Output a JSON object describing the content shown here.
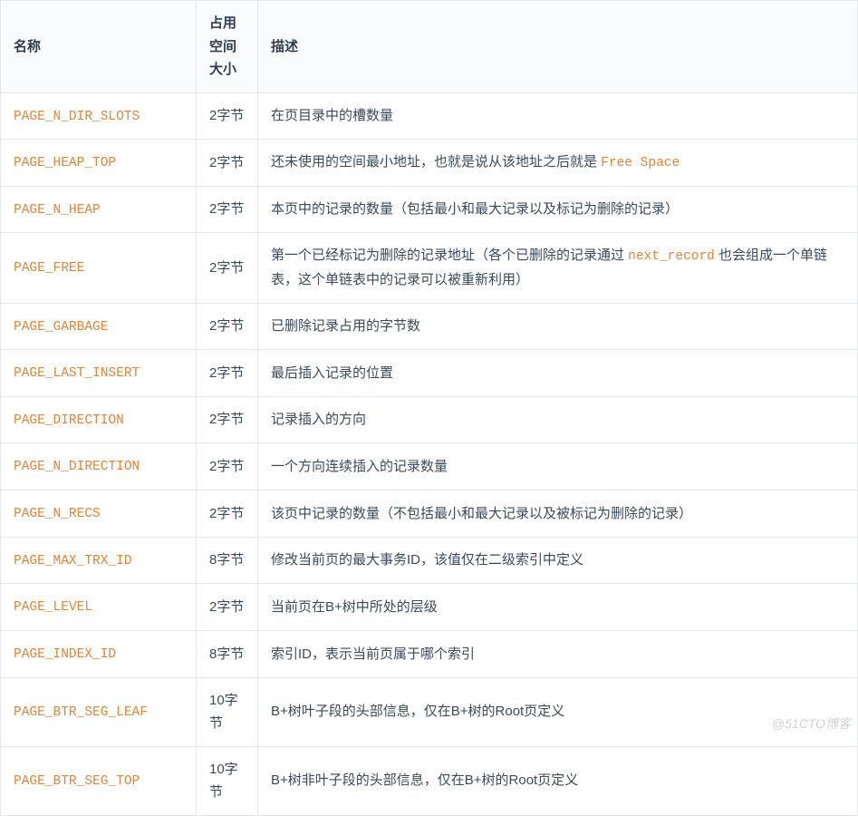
{
  "headers": {
    "name": "名称",
    "size": "占用空间大小",
    "desc": "描述"
  },
  "rows": [
    {
      "name": "PAGE_N_DIR_SLOTS",
      "size": "2字节",
      "desc_pre": "在页目录中的槽数量",
      "code": "",
      "desc_post": ""
    },
    {
      "name": "PAGE_HEAP_TOP",
      "size": "2字节",
      "desc_pre": "还未使用的空间最小地址，也就是说从该地址之后就是 ",
      "code": "Free Space",
      "desc_post": ""
    },
    {
      "name": "PAGE_N_HEAP",
      "size": "2字节",
      "desc_pre": "本页中的记录的数量（包括最小和最大记录以及标记为删除的记录）",
      "code": "",
      "desc_post": ""
    },
    {
      "name": "PAGE_FREE",
      "size": "2字节",
      "desc_pre": "第一个已经标记为删除的记录地址（各个已删除的记录通过 ",
      "code": "next_record",
      "desc_post": " 也会组成一个单链表，这个单链表中的记录可以被重新利用）"
    },
    {
      "name": "PAGE_GARBAGE",
      "size": "2字节",
      "desc_pre": "已删除记录占用的字节数",
      "code": "",
      "desc_post": ""
    },
    {
      "name": "PAGE_LAST_INSERT",
      "size": "2字节",
      "desc_pre": "最后插入记录的位置",
      "code": "",
      "desc_post": ""
    },
    {
      "name": "PAGE_DIRECTION",
      "size": "2字节",
      "desc_pre": "记录插入的方向",
      "code": "",
      "desc_post": ""
    },
    {
      "name": "PAGE_N_DIRECTION",
      "size": "2字节",
      "desc_pre": "一个方向连续插入的记录数量",
      "code": "",
      "desc_post": ""
    },
    {
      "name": "PAGE_N_RECS",
      "size": "2字节",
      "desc_pre": "该页中记录的数量（不包括最小和最大记录以及被标记为删除的记录）",
      "code": "",
      "desc_post": ""
    },
    {
      "name": "PAGE_MAX_TRX_ID",
      "size": "8字节",
      "desc_pre": "修改当前页的最大事务ID，该值仅在二级索引中定义",
      "code": "",
      "desc_post": ""
    },
    {
      "name": "PAGE_LEVEL",
      "size": "2字节",
      "desc_pre": "当前页在B+树中所处的层级",
      "code": "",
      "desc_post": ""
    },
    {
      "name": "PAGE_INDEX_ID",
      "size": "8字节",
      "desc_pre": "索引ID，表示当前页属于哪个索引",
      "code": "",
      "desc_post": ""
    },
    {
      "name": "PAGE_BTR_SEG_LEAF",
      "size": "10字节",
      "desc_pre": "B+树叶子段的头部信息，仅在B+树的Root页定义",
      "code": "",
      "desc_post": ""
    },
    {
      "name": "PAGE_BTR_SEG_TOP",
      "size": "10字节",
      "desc_pre": "B+树非叶子段的头部信息，仅在B+树的Root页定义",
      "code": "",
      "desc_post": ""
    }
  ],
  "watermark": "@51CTO博客"
}
